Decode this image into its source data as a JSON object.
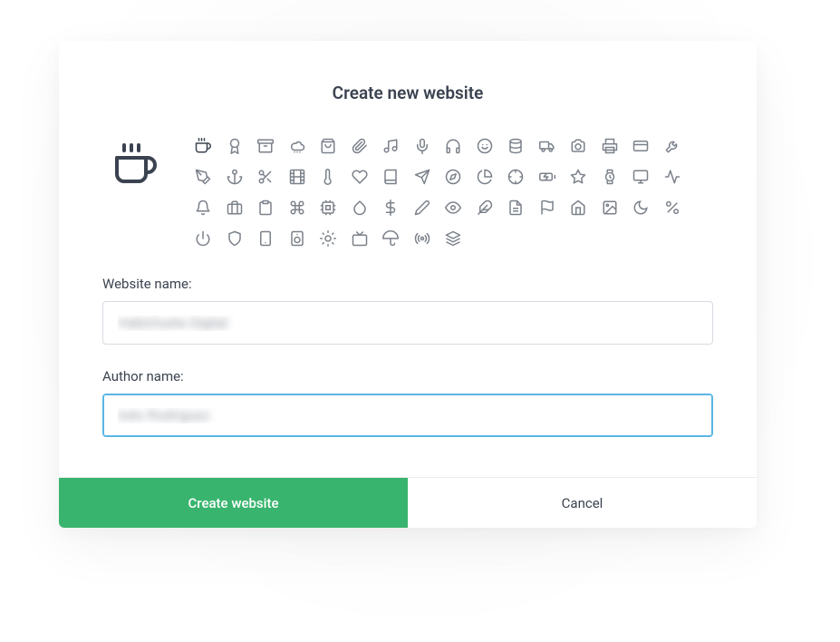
{
  "dialog": {
    "title": "Create new website",
    "selected_icon": "coffee",
    "icons": [
      "coffee",
      "award",
      "archive",
      "cloud-snow",
      "shopping-bag",
      "paperclip",
      "music",
      "mic",
      "headphones",
      "smile",
      "database",
      "truck",
      "camera",
      "printer",
      "credit-card",
      "wrench",
      "pen-nib",
      "anchor",
      "scissors",
      "film",
      "thermometer",
      "heart",
      "book",
      "send",
      "compass",
      "pie-chart",
      "crosshair",
      "battery-charging",
      "star",
      "watch",
      "monitor",
      "activity",
      "bell",
      "briefcase",
      "clipboard",
      "command",
      "cpu",
      "droplet",
      "dollar",
      "edit",
      "eye",
      "feather",
      "file-text",
      "flag",
      "home",
      "image",
      "moon",
      "percent",
      "power",
      "shield",
      "smartphone",
      "speaker",
      "sun",
      "tv",
      "umbrella",
      "radio",
      "layers"
    ],
    "website_name": {
      "label": "Website name:",
      "value": "Habichuela Digital"
    },
    "author_name": {
      "label": "Author name:",
      "value": "Inés Rodríguez"
    },
    "actions": {
      "create": "Create website",
      "cancel": "Cancel"
    }
  },
  "colors": {
    "primary": "#39b46e",
    "focus_border": "#5ab6e4"
  }
}
